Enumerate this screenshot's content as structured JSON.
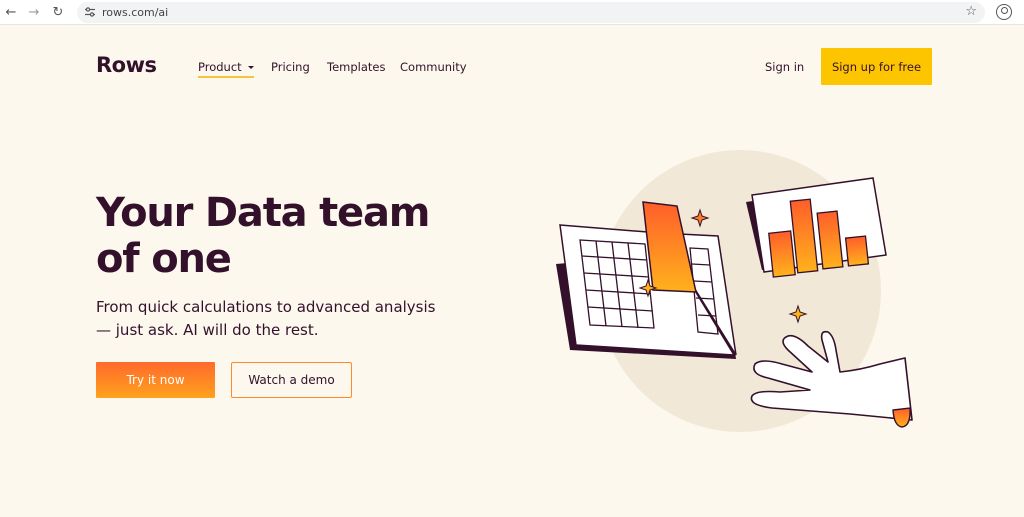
{
  "browser": {
    "url": "rows.com/ai"
  },
  "site": {
    "logo": "Rows",
    "nav": [
      {
        "label": "Product",
        "has_dropdown": true
      },
      {
        "label": "Pricing"
      },
      {
        "label": "Templates"
      },
      {
        "label": "Community"
      }
    ],
    "sign_in": "Sign in",
    "sign_up": "Sign up for free"
  },
  "hero": {
    "title_line1": "Your Data team",
    "title_line2": "of one",
    "subtitle_line1": "From quick calculations to advanced analysis",
    "subtitle_line2": "— just ask. AI will do the rest.",
    "primary_cta": "Try it now",
    "secondary_cta": "Watch a demo"
  },
  "colors": {
    "background": "#fcf8ee",
    "text": "#34112b",
    "cta_yellow": "#fdc500",
    "orange": "#ff6a2c"
  }
}
